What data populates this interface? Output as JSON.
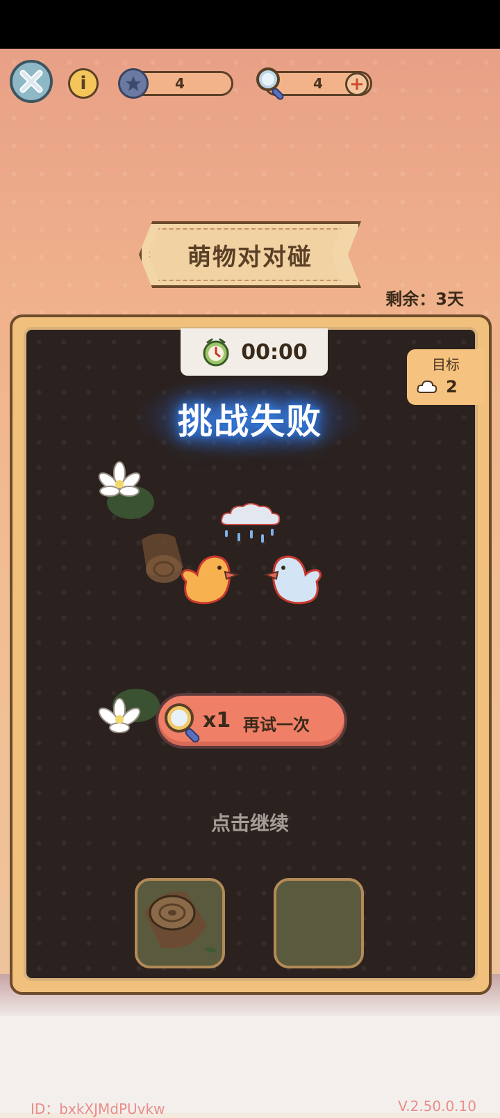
{
  "hud": {
    "stars_count": "4",
    "magnifier_count": "4",
    "plus": "+",
    "info": "i"
  },
  "banner": {
    "title": "萌物对对碰"
  },
  "remaining": "剩余：3天",
  "timer": "00:00",
  "goal": {
    "label": "目标",
    "count": "2",
    "icon": "cloud-icon"
  },
  "result": {
    "title": "挑战失败"
  },
  "retry": {
    "multiplier": "x1",
    "label": "再试一次",
    "icon": "magnifier-icon"
  },
  "tap_continue": "点击继续",
  "footer": {
    "id": "ID：bxkXJMdPUvkw",
    "version": "V.2.50.0.10"
  },
  "colors": {
    "board_bg": "#2b211f",
    "retry_bg": "#f07f68",
    "glow": "#3b8cff"
  }
}
